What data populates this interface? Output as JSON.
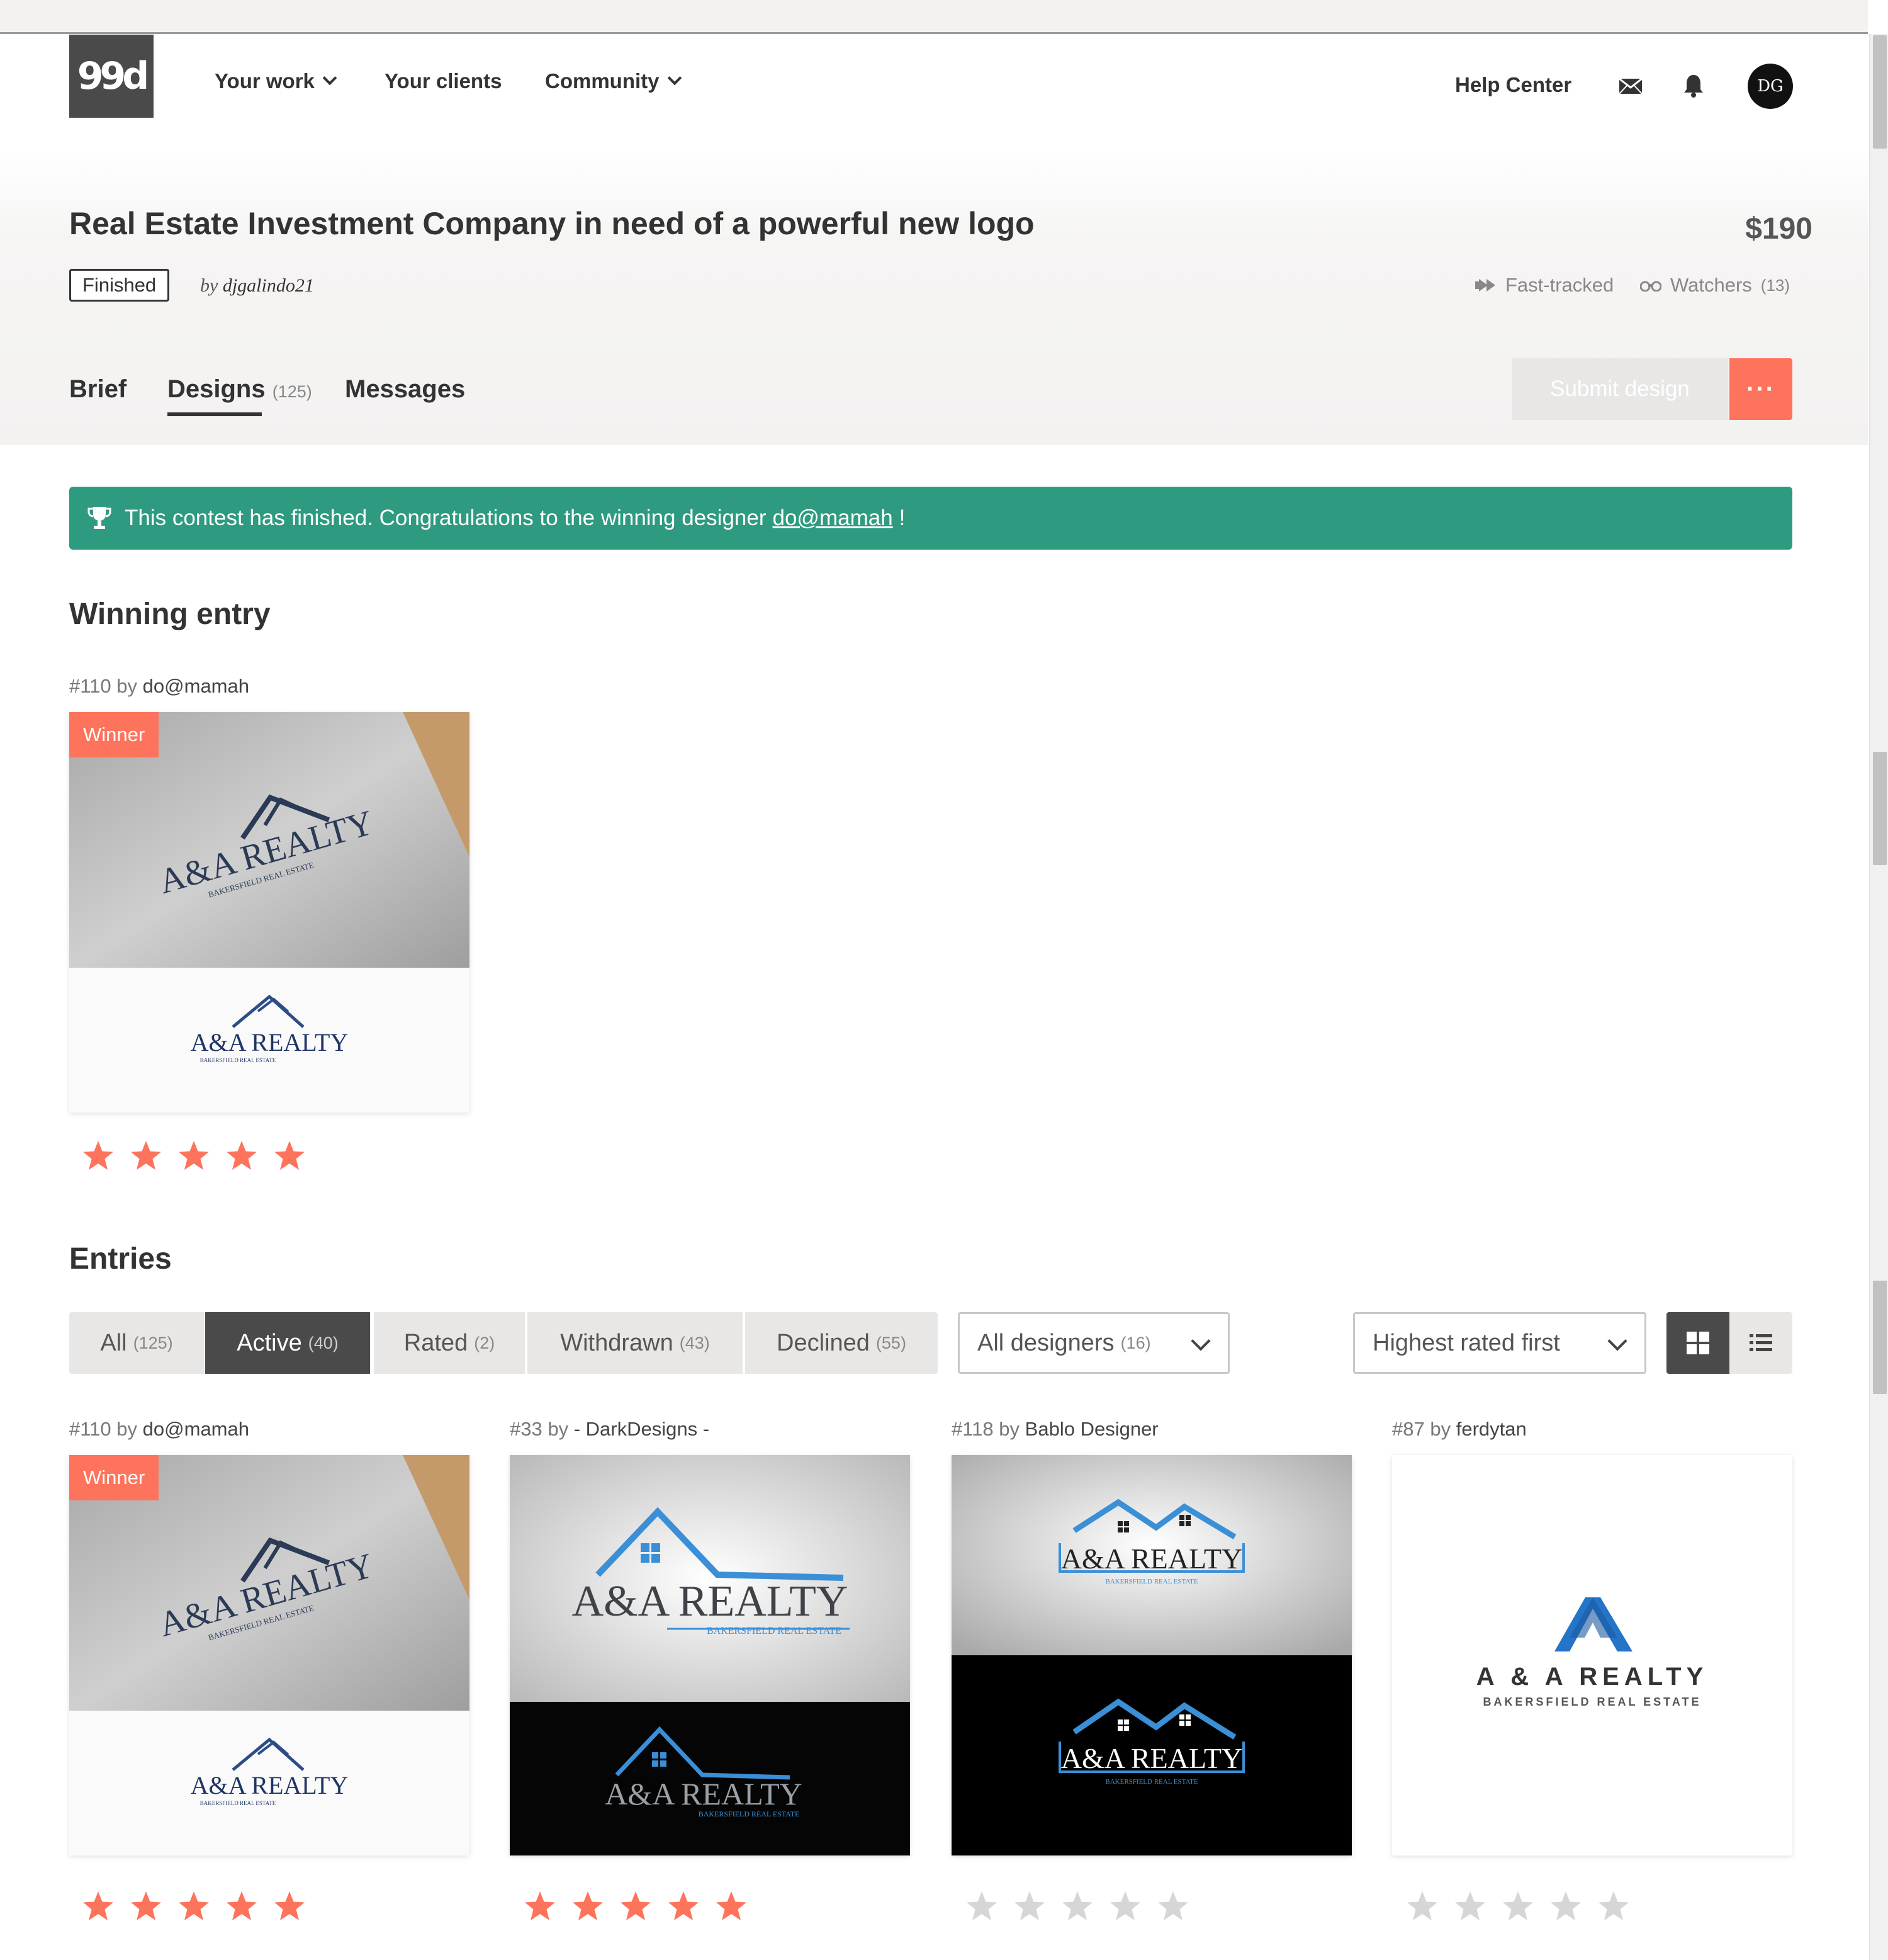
{
  "nav": {
    "logo": "99d",
    "your_work": "Your work",
    "your_clients": "Your clients",
    "community": "Community",
    "help_center": "Help Center",
    "avatar_initials": "DG"
  },
  "contest": {
    "title": "Real Estate Investment Company in need of a powerful new logo",
    "price": "$190",
    "status": "Finished",
    "by_prefix": "by",
    "owner": "djgalindo21",
    "fast_tracked": "Fast-tracked",
    "watchers_label": "Watchers",
    "watchers_count": "(13)"
  },
  "tabs": {
    "brief": "Brief",
    "designs": "Designs",
    "designs_count": "(125)",
    "messages": "Messages",
    "submit": "Submit design",
    "more": "···"
  },
  "banner": {
    "text": "This contest has finished. Congratulations to the winning designer",
    "designer": "do@mamah",
    "suffix": "!"
  },
  "winning": {
    "title": "Winning entry",
    "number": "#110",
    "by": "by",
    "designer": "do@mamah",
    "badge": "Winner",
    "rating": 5
  },
  "entries": {
    "title": "Entries",
    "filters": [
      {
        "label": "All",
        "count": "(125)"
      },
      {
        "label": "Active",
        "count": "(40)"
      },
      {
        "label": "Rated",
        "count": "(2)"
      },
      {
        "label": "Withdrawn",
        "count": "(43)"
      },
      {
        "label": "Declined",
        "count": "(55)"
      }
    ],
    "designers_select": {
      "label": "All designers",
      "count": "(16)"
    },
    "sort_select": {
      "label": "Highest rated first"
    },
    "items": [
      {
        "number": "#110",
        "by": "by",
        "designer": "do@mamah",
        "badge": "Winner",
        "rating": 5
      },
      {
        "number": "#33",
        "by": "by",
        "designer": "- DarkDesigns -",
        "rating": 5
      },
      {
        "number": "#118",
        "by": "by",
        "designer": "Bablo Designer",
        "rating": 0
      },
      {
        "number": "#87",
        "by": "by",
        "designer": "ferdytan",
        "rating": 0
      }
    ]
  },
  "logo_text": {
    "brand": "A&A REALTY",
    "brand_spaced": "A & A  REALTY",
    "tagline": "BAKERSFIELD REAL ESTATE"
  },
  "colors": {
    "accent": "#fe735b",
    "banner": "#2e9b80",
    "logo_navy": "#1f3566",
    "logo_blue": "#3a8fd6",
    "star_empty": "#d6d6d6"
  }
}
